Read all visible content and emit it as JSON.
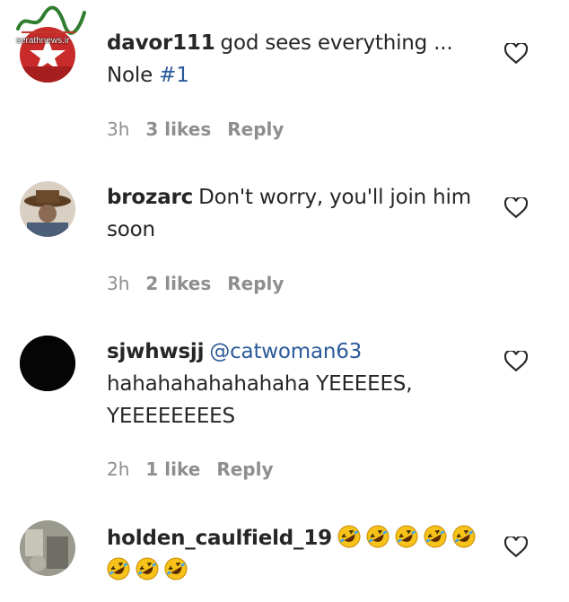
{
  "watermark": {
    "url": "serathnews.ir"
  },
  "comments": [
    {
      "username": "davor111",
      "text": "god sees everything ... Nole",
      "hashtag": "#1",
      "time": "3h",
      "likes": "3 likes",
      "reply": "Reply",
      "avatar": "red-star-avatar"
    },
    {
      "username": "brozarc",
      "text": "Don't worry, you'll join him soon",
      "time": "3h",
      "likes": "2 likes",
      "reply": "Reply",
      "avatar": "person-hat-avatar"
    },
    {
      "username": "sjwhwsjj",
      "mention": "@catwoman63",
      "text": "hahahahahahahaha YEEEEES, YEEEEEEEES",
      "time": "2h",
      "likes": "1 like",
      "reply": "Reply",
      "avatar": "black-avatar"
    },
    {
      "username": "holden_caulfield_19",
      "emoji_count": 8,
      "emoji": "rolling-on-floor-laughing-emoji",
      "avatar": "gray-photo-avatar"
    }
  ],
  "colors": {
    "username": "#262626",
    "meta": "#8e8e8e",
    "link": "#2b5a9a"
  },
  "icons": {
    "like": "heart-outline-icon"
  }
}
